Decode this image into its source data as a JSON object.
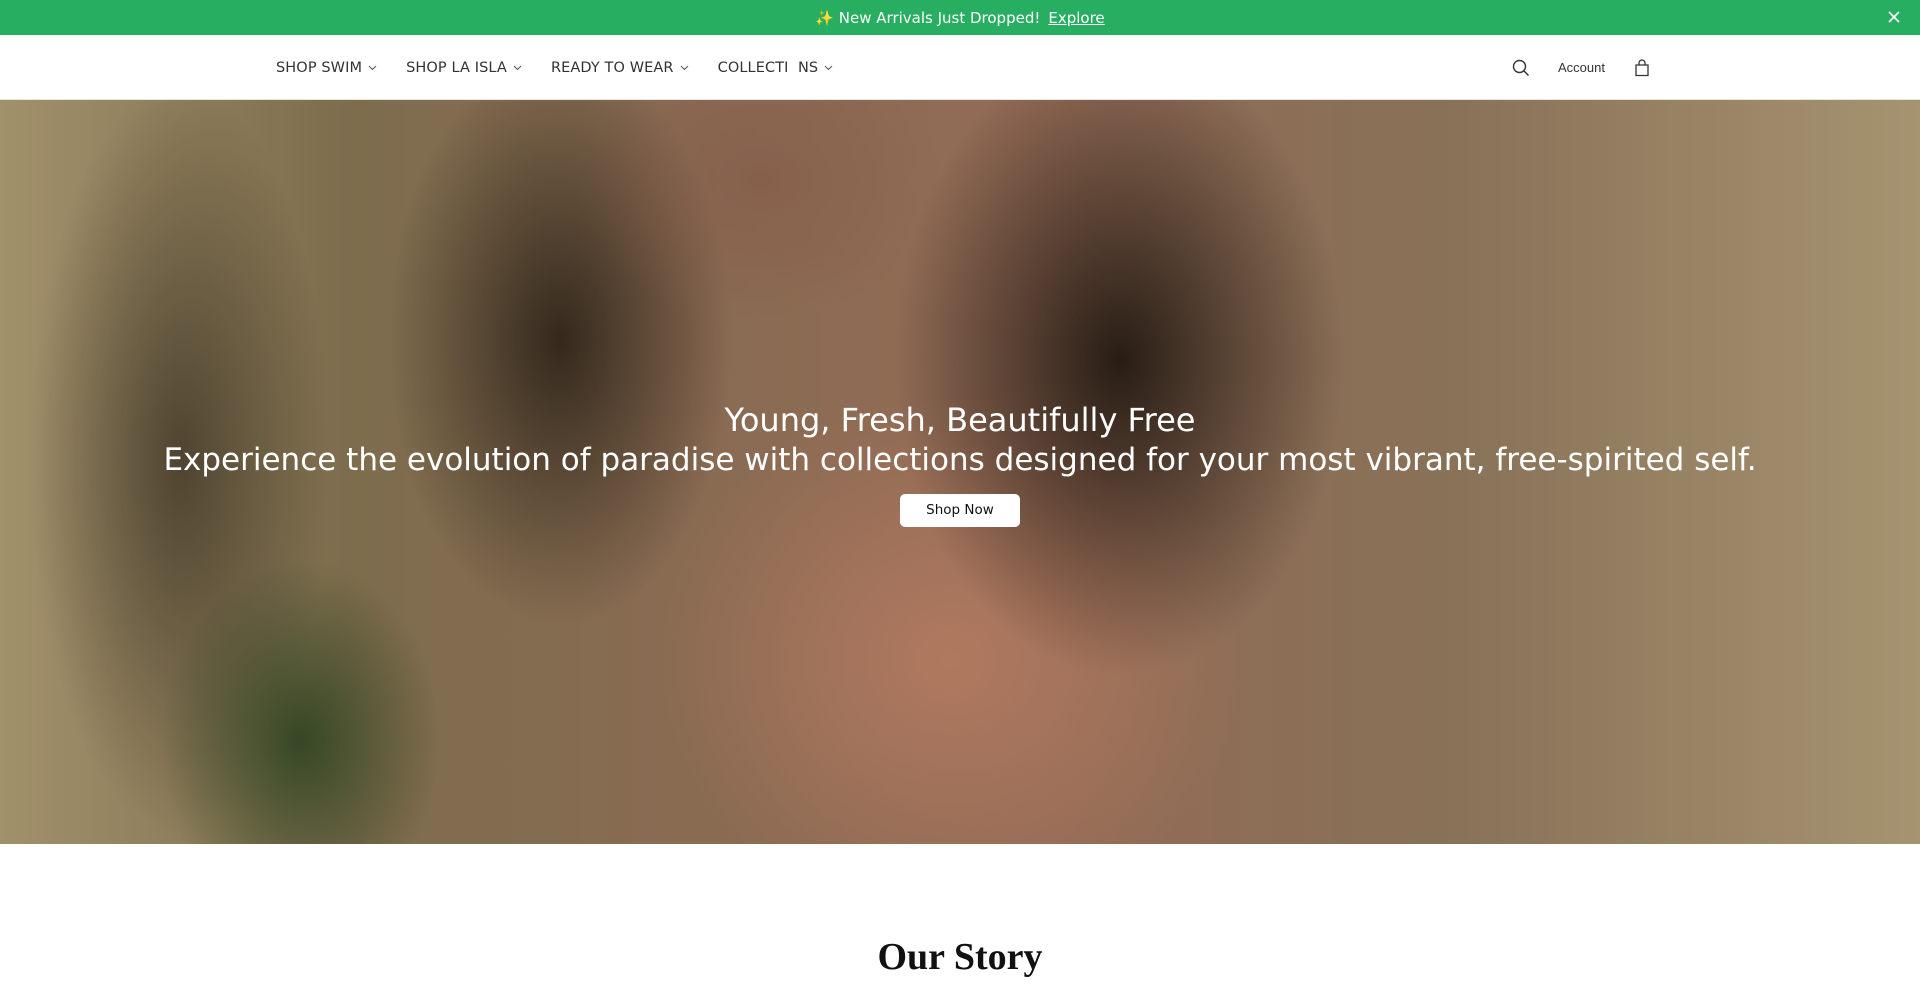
{
  "announcement": {
    "message": "✨ New Arrivals Just Dropped!",
    "link_label": "Explore",
    "close_glyph": "×",
    "background": "#28ae60"
  },
  "nav": {
    "items": [
      {
        "label": "SHOP SWIM"
      },
      {
        "label": "SHOP LA ISLA"
      },
      {
        "label": "READY TO WEAR"
      },
      {
        "label": "COLLECTI  NS"
      }
    ]
  },
  "header_actions": {
    "search_icon": "search-icon",
    "account_label": "Account",
    "bag_icon": "shopping-bag-icon"
  },
  "hero": {
    "title": "Young, Fresh, Beautifully Free",
    "subtitle": "Experience the evolution of paradise with collections designed for your most vibrant, free-spirited self.",
    "cta_label": "Shop Now"
  },
  "story": {
    "title": "Our Story"
  }
}
